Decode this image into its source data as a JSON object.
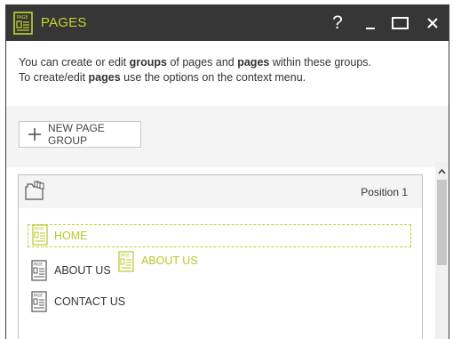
{
  "window": {
    "title": "PAGES",
    "help_label": "?"
  },
  "info": {
    "line1_pre": "You can create or edit ",
    "line1_b1": "groups",
    "line1_mid": " of pages and ",
    "line1_b2": "pages",
    "line1_post": " within these groups.",
    "line2_pre": "To create/edit ",
    "line2_b": "pages",
    "line2_post": " use the options on the context menu."
  },
  "toolbar": {
    "new_group_label": "NEW PAGE GROUP"
  },
  "group": {
    "position_label": "Position 1",
    "pages": [
      {
        "label": "HOME",
        "state": "drop-target"
      },
      {
        "label": "ABOUT US",
        "state": "normal"
      },
      {
        "label": "CONTACT US",
        "state": "normal"
      }
    ]
  },
  "drag_ghost": {
    "label": "ABOUT US"
  },
  "colors": {
    "accent": "#c3d62c",
    "titlebar": "#363636",
    "band": "#f4f4f4"
  }
}
